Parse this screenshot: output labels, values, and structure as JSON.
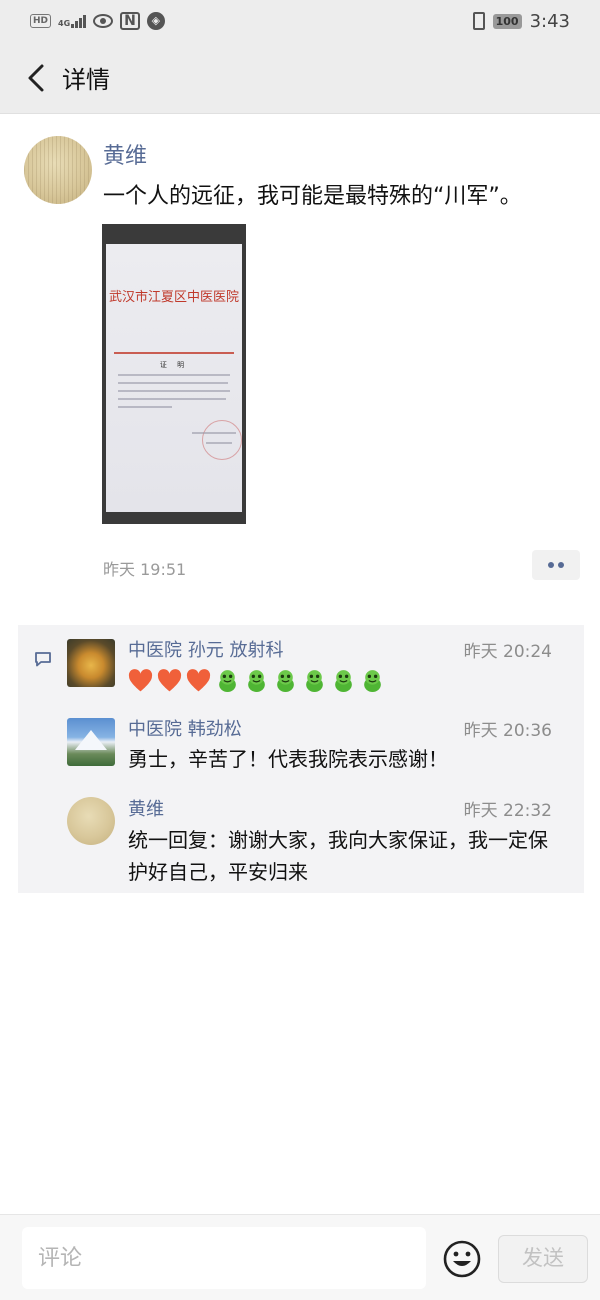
{
  "status_bar": {
    "left_badge": "HD",
    "network": "4G",
    "time": "3:43",
    "battery": "100"
  },
  "navbar": {
    "title": "详情"
  },
  "post": {
    "author": "黄维",
    "text": "一个人的远征，我可能是最特殊的“川军”。",
    "photo": {
      "doc_title": "武汉市江夏区中医医院",
      "doc_subtitle": "证 明"
    },
    "time": "昨天 19:51"
  },
  "comments": [
    {
      "name": "中医院 孙元 放射科",
      "time": "昨天 20:24",
      "emoji": [
        "heart",
        "heart",
        "heart",
        "frog",
        "frog",
        "frog",
        "frog",
        "frog",
        "frog"
      ]
    },
    {
      "name": "中医院 韩劲松",
      "time": "昨天 20:36",
      "text": "勇士，辛苦了！代表我院表示感谢！"
    },
    {
      "name": "黄维",
      "time": "昨天 22:32",
      "text": "统一回复：谢谢大家，我向大家保证，我一定保护好自己，平安归来"
    }
  ],
  "input_bar": {
    "placeholder": "评论",
    "send_label": "发送"
  },
  "icons": {
    "back": "chevron-left-icon",
    "more": "more-dots-icon",
    "comment": "comment-bubble-icon",
    "emoji": "smiley-icon"
  },
  "colors": {
    "link_blue": "#576b95",
    "header_bg": "#ededed",
    "comments_bg": "#f3f3f5"
  }
}
